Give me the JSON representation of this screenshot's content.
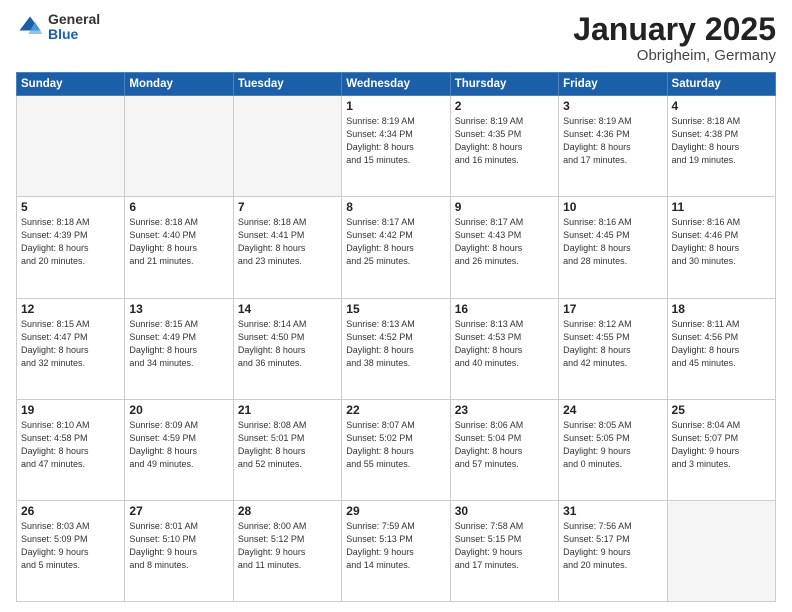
{
  "logo": {
    "general": "General",
    "blue": "Blue"
  },
  "header": {
    "month": "January 2025",
    "location": "Obrigheim, Germany"
  },
  "weekdays": [
    "Sunday",
    "Monday",
    "Tuesday",
    "Wednesday",
    "Thursday",
    "Friday",
    "Saturday"
  ],
  "weeks": [
    [
      {
        "day": "",
        "info": ""
      },
      {
        "day": "",
        "info": ""
      },
      {
        "day": "",
        "info": ""
      },
      {
        "day": "1",
        "info": "Sunrise: 8:19 AM\nSunset: 4:34 PM\nDaylight: 8 hours\nand 15 minutes."
      },
      {
        "day": "2",
        "info": "Sunrise: 8:19 AM\nSunset: 4:35 PM\nDaylight: 8 hours\nand 16 minutes."
      },
      {
        "day": "3",
        "info": "Sunrise: 8:19 AM\nSunset: 4:36 PM\nDaylight: 8 hours\nand 17 minutes."
      },
      {
        "day": "4",
        "info": "Sunrise: 8:18 AM\nSunset: 4:38 PM\nDaylight: 8 hours\nand 19 minutes."
      }
    ],
    [
      {
        "day": "5",
        "info": "Sunrise: 8:18 AM\nSunset: 4:39 PM\nDaylight: 8 hours\nand 20 minutes."
      },
      {
        "day": "6",
        "info": "Sunrise: 8:18 AM\nSunset: 4:40 PM\nDaylight: 8 hours\nand 21 minutes."
      },
      {
        "day": "7",
        "info": "Sunrise: 8:18 AM\nSunset: 4:41 PM\nDaylight: 8 hours\nand 23 minutes."
      },
      {
        "day": "8",
        "info": "Sunrise: 8:17 AM\nSunset: 4:42 PM\nDaylight: 8 hours\nand 25 minutes."
      },
      {
        "day": "9",
        "info": "Sunrise: 8:17 AM\nSunset: 4:43 PM\nDaylight: 8 hours\nand 26 minutes."
      },
      {
        "day": "10",
        "info": "Sunrise: 8:16 AM\nSunset: 4:45 PM\nDaylight: 8 hours\nand 28 minutes."
      },
      {
        "day": "11",
        "info": "Sunrise: 8:16 AM\nSunset: 4:46 PM\nDaylight: 8 hours\nand 30 minutes."
      }
    ],
    [
      {
        "day": "12",
        "info": "Sunrise: 8:15 AM\nSunset: 4:47 PM\nDaylight: 8 hours\nand 32 minutes."
      },
      {
        "day": "13",
        "info": "Sunrise: 8:15 AM\nSunset: 4:49 PM\nDaylight: 8 hours\nand 34 minutes."
      },
      {
        "day": "14",
        "info": "Sunrise: 8:14 AM\nSunset: 4:50 PM\nDaylight: 8 hours\nand 36 minutes."
      },
      {
        "day": "15",
        "info": "Sunrise: 8:13 AM\nSunset: 4:52 PM\nDaylight: 8 hours\nand 38 minutes."
      },
      {
        "day": "16",
        "info": "Sunrise: 8:13 AM\nSunset: 4:53 PM\nDaylight: 8 hours\nand 40 minutes."
      },
      {
        "day": "17",
        "info": "Sunrise: 8:12 AM\nSunset: 4:55 PM\nDaylight: 8 hours\nand 42 minutes."
      },
      {
        "day": "18",
        "info": "Sunrise: 8:11 AM\nSunset: 4:56 PM\nDaylight: 8 hours\nand 45 minutes."
      }
    ],
    [
      {
        "day": "19",
        "info": "Sunrise: 8:10 AM\nSunset: 4:58 PM\nDaylight: 8 hours\nand 47 minutes."
      },
      {
        "day": "20",
        "info": "Sunrise: 8:09 AM\nSunset: 4:59 PM\nDaylight: 8 hours\nand 49 minutes."
      },
      {
        "day": "21",
        "info": "Sunrise: 8:08 AM\nSunset: 5:01 PM\nDaylight: 8 hours\nand 52 minutes."
      },
      {
        "day": "22",
        "info": "Sunrise: 8:07 AM\nSunset: 5:02 PM\nDaylight: 8 hours\nand 55 minutes."
      },
      {
        "day": "23",
        "info": "Sunrise: 8:06 AM\nSunset: 5:04 PM\nDaylight: 8 hours\nand 57 minutes."
      },
      {
        "day": "24",
        "info": "Sunrise: 8:05 AM\nSunset: 5:05 PM\nDaylight: 9 hours\nand 0 minutes."
      },
      {
        "day": "25",
        "info": "Sunrise: 8:04 AM\nSunset: 5:07 PM\nDaylight: 9 hours\nand 3 minutes."
      }
    ],
    [
      {
        "day": "26",
        "info": "Sunrise: 8:03 AM\nSunset: 5:09 PM\nDaylight: 9 hours\nand 5 minutes."
      },
      {
        "day": "27",
        "info": "Sunrise: 8:01 AM\nSunset: 5:10 PM\nDaylight: 9 hours\nand 8 minutes."
      },
      {
        "day": "28",
        "info": "Sunrise: 8:00 AM\nSunset: 5:12 PM\nDaylight: 9 hours\nand 11 minutes."
      },
      {
        "day": "29",
        "info": "Sunrise: 7:59 AM\nSunset: 5:13 PM\nDaylight: 9 hours\nand 14 minutes."
      },
      {
        "day": "30",
        "info": "Sunrise: 7:58 AM\nSunset: 5:15 PM\nDaylight: 9 hours\nand 17 minutes."
      },
      {
        "day": "31",
        "info": "Sunrise: 7:56 AM\nSunset: 5:17 PM\nDaylight: 9 hours\nand 20 minutes."
      },
      {
        "day": "",
        "info": ""
      }
    ]
  ]
}
